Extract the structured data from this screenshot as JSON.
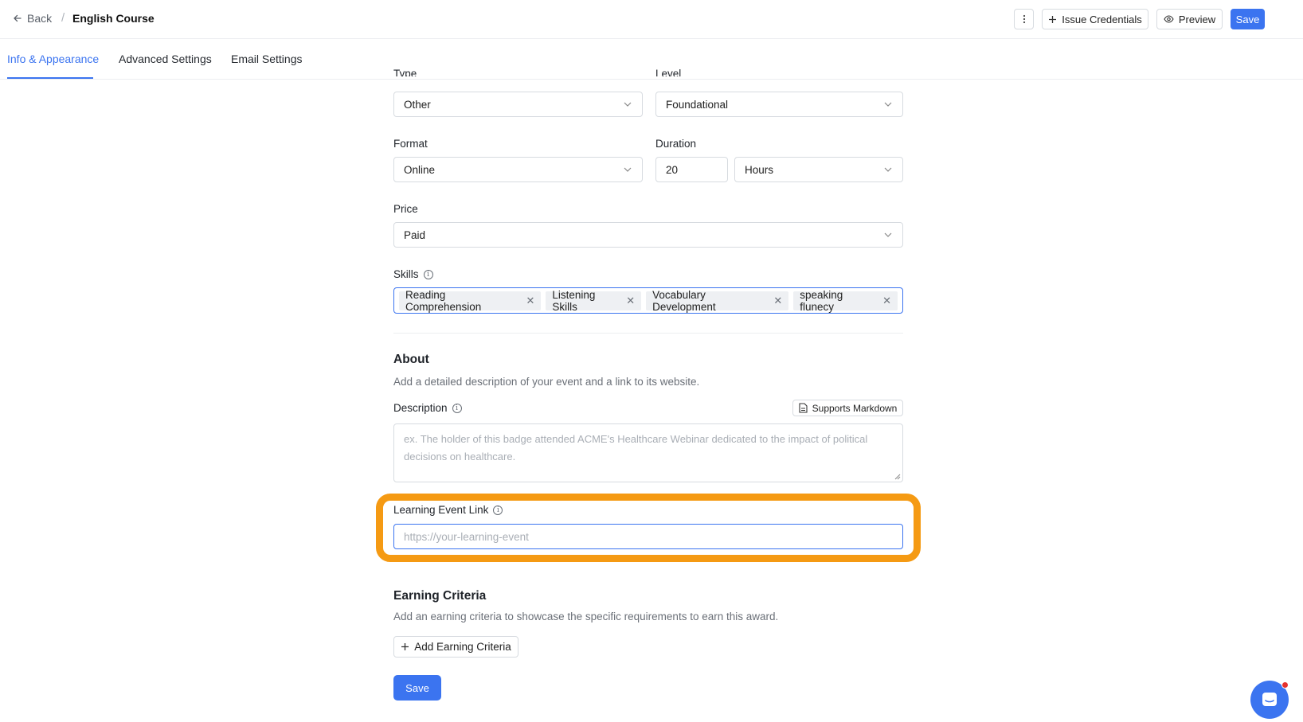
{
  "header": {
    "back_label": "Back",
    "title": "English Course",
    "more_icon": "more-vertical-icon",
    "issue_label": "Issue Credentials",
    "preview_label": "Preview",
    "save_label": "Save"
  },
  "tabs": [
    {
      "label": "Info & Appearance",
      "active": true
    },
    {
      "label": "Advanced Settings",
      "active": false
    },
    {
      "label": "Email Settings",
      "active": false
    }
  ],
  "form": {
    "type": {
      "label": "Type",
      "value": "Other"
    },
    "level": {
      "label": "Level",
      "value": "Foundational"
    },
    "format": {
      "label": "Format",
      "value": "Online"
    },
    "duration": {
      "label": "Duration",
      "value": "20",
      "unit": "Hours"
    },
    "price": {
      "label": "Price",
      "value": "Paid"
    },
    "skills": {
      "label": "Skills",
      "chips": [
        "Reading Comprehension",
        "Listening Skills",
        "Vocabulary Development",
        "speaking flunecy"
      ]
    }
  },
  "about": {
    "title": "About",
    "subtitle": "Add a detailed description of your event and a link to its website.",
    "description_label": "Description",
    "markdown_label": "Supports Markdown",
    "description_placeholder": "ex. The holder of this badge attended ACME's Healthcare Webinar dedicated to the impact of political decisions on healthcare.",
    "link_label": "Learning Event Link",
    "link_placeholder": "https://your-learning-event"
  },
  "earning": {
    "title": "Earning Criteria",
    "subtitle": "Add an earning criteria to showcase the specific requirements to earn this award.",
    "add_label": "Add Earning Criteria"
  },
  "footer": {
    "save_label": "Save"
  },
  "colors": {
    "accent": "#3b74f0",
    "highlight": "#f59a13",
    "notification": "#e5322d"
  }
}
